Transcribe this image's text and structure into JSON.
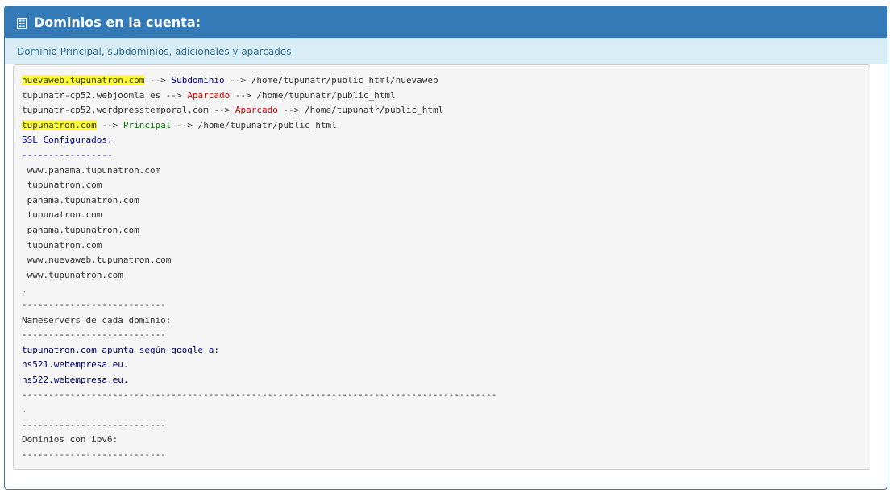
{
  "panel": {
    "title": "Dominios en la cuenta:",
    "subtitle": "Dominio Principal, subdominios, adicionales y aparcados"
  },
  "arrow": " --> ",
  "domains": [
    {
      "domain": "nuevaweb.tupunatron.com",
      "type": "Subdominio",
      "path": "/home/tupunatr/public_html/nuevaweb"
    },
    {
      "domain": "tupunatr-cp52.webjoomla.es",
      "type": "Aparcado",
      "path": "/home/tupunatr/public_html"
    },
    {
      "domain": "tupunatr-cp52.wordpresstemporal.com",
      "type": "Aparcado",
      "path": "/home/tupunatr/public_html"
    },
    {
      "domain": "tupunatron.com",
      "type": "Principal",
      "path": "/home/tupunatr/public_html"
    }
  ],
  "ssl": {
    "heading": "SSL Configurados:",
    "separator": "-----------------",
    "entries": [
      " www.panama.tupunatron.com",
      " tupunatron.com",
      " panama.tupunatron.com",
      " tupunatron.com",
      " panama.tupunatron.com",
      " tupunatron.com",
      " www.nuevaweb.tupunatron.com",
      " www.tupunatron.com"
    ],
    "end_dot": "."
  },
  "nameservers": {
    "separator_top": "---------------------------",
    "heading": "Nameservers de cada dominio:",
    "separator_bottom": "---------------------------",
    "query": "tupunatron.com apunta según google a:",
    "servers": [
      "ns521.webempresa.eu.",
      "ns522.webempresa.eu."
    ],
    "long_separator": "-----------------------------------------------------------------------------------------",
    "end_dot": "."
  },
  "ipv6": {
    "separator_top": "---------------------------",
    "heading": "Dominios con ipv6:",
    "separator_bottom": "---------------------------"
  },
  "colors": {
    "header_bg": "#337ab7",
    "subheader_bg": "#d9edf7",
    "highlight": "#ffff33",
    "subdominio": "#000099",
    "aparcado": "#cc0000",
    "principal": "#007700"
  }
}
